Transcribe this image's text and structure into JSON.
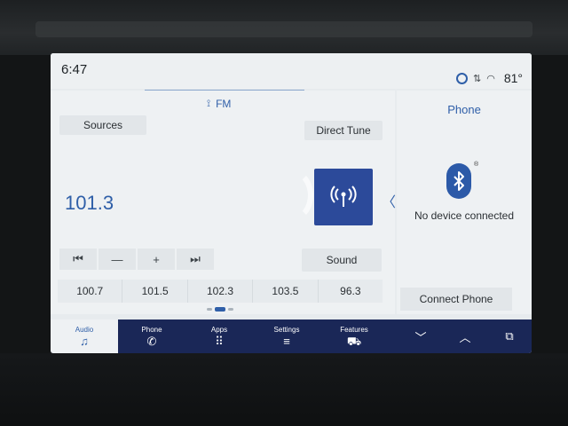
{
  "status": {
    "time": "6:47",
    "temperature": "81°",
    "icons": [
      "assistant-circle-icon",
      "signal-icon",
      "wifi-icon"
    ]
  },
  "audio": {
    "band_label": "FM",
    "sources_label": "Sources",
    "direct_tune_label": "Direct Tune",
    "frequency": "101.3",
    "sound_label": "Sound",
    "controls": {
      "seek_back": "⏮",
      "minus": "—",
      "plus": "+",
      "seek_forward": "⏭"
    },
    "presets": [
      "100.7",
      "101.5",
      "102.3",
      "103.5",
      "96.3"
    ]
  },
  "phone": {
    "title": "Phone",
    "status_text": "No device connected",
    "connect_label": "Connect Phone"
  },
  "nav": {
    "items": [
      {
        "label": "Audio",
        "icon": "♫"
      },
      {
        "label": "Phone",
        "icon": "✆"
      },
      {
        "label": "Apps",
        "icon": "⠿"
      },
      {
        "label": "Settings",
        "icon": "≡"
      },
      {
        "label": "Features",
        "icon": "⛟"
      }
    ],
    "chevron_down": "﹀",
    "chevron_up": "︿",
    "overlay": "⧉"
  },
  "colors": {
    "accent": "#2f5fa8",
    "nav_bg": "#1a2757",
    "tile_bg": "#2c4a9a"
  }
}
